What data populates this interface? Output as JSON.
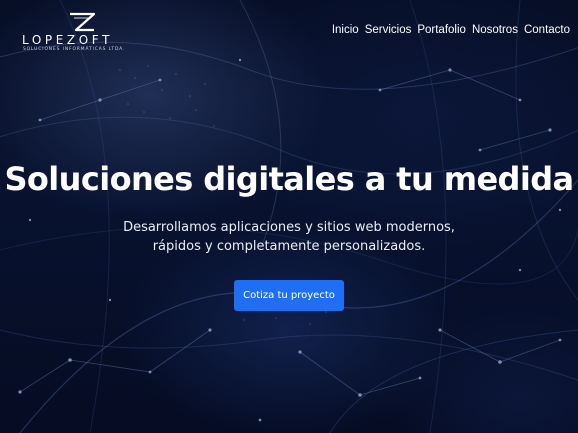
{
  "brand": {
    "name": "LOPEZOFT",
    "tagline": "SOLUCIONES INFORMÁTICAS LTDA."
  },
  "nav": {
    "items": [
      {
        "label": "Inicio"
      },
      {
        "label": "Servicios"
      },
      {
        "label": "Portafolio"
      },
      {
        "label": "Nosotros"
      },
      {
        "label": "Contacto"
      }
    ]
  },
  "hero": {
    "title": "Soluciones digitales a tu medida",
    "subtitle": "Desarrollamos aplicaciones y sitios web modernos, rápidos y completamente personalizados.",
    "cta_label": "Cotiza tu proyecto"
  },
  "colors": {
    "background": "#0a1535",
    "accent": "#1f6ff5",
    "text": "#ffffff"
  }
}
